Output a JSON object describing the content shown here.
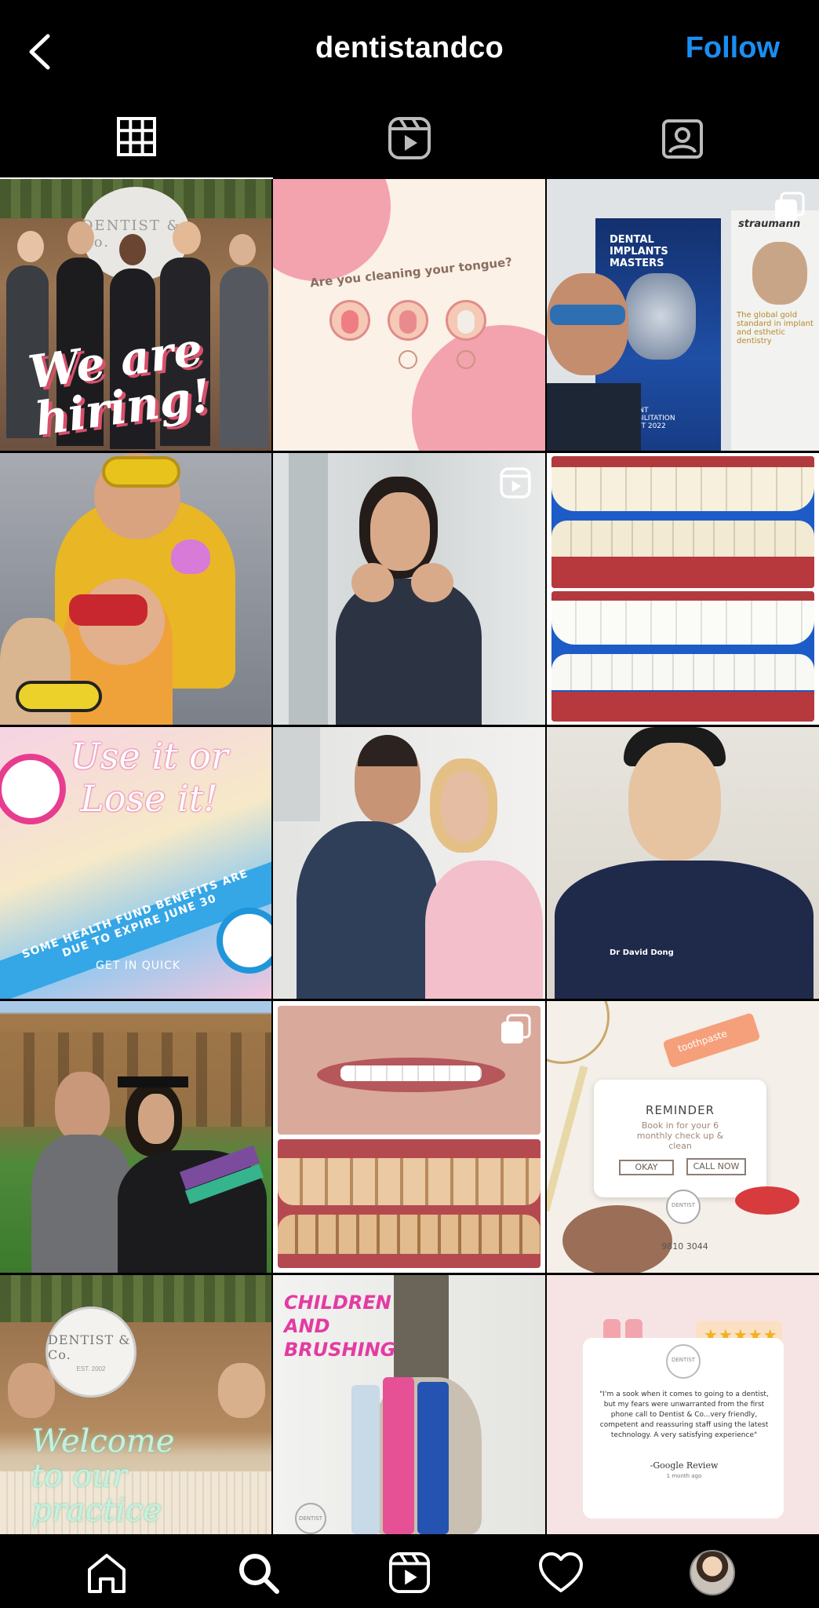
{
  "header": {
    "username": "dentistandco",
    "follow_label": "Follow"
  },
  "tabs": [
    {
      "icon": "grid-icon",
      "active": true
    },
    {
      "icon": "reels-icon",
      "active": false
    },
    {
      "icon": "tagged-icon",
      "active": false
    }
  ],
  "posts": [
    {
      "caption": "We are hiring!",
      "sign": "DENTIST & Co."
    },
    {
      "caption": "Are you cleaning your tongue?"
    },
    {
      "caption": "DENTAL IMPLANTS MASTERS",
      "sub": "IMPLANT REHABILITATION SUMMIT 2022",
      "side": "straumann",
      "side_text": "The global gold standard in implant and esthetic dentistry"
    },
    {
      "caption": ""
    },
    {
      "caption": ""
    },
    {
      "caption": ""
    },
    {
      "caption": "Use it or Lose it!",
      "sub": "SOME HEALTH FUND BENEFITS ARE DUE TO EXPIRE JUNE 30",
      "foot": "GET IN QUICK"
    },
    {
      "caption": ""
    },
    {
      "caption": "Dr David Dong"
    },
    {
      "caption": ""
    },
    {
      "caption": ""
    },
    {
      "caption": "REMINDER",
      "sub": "Book in for your 6 monthly check up & clean",
      "btn1": "OKAY",
      "btn2": "CALL NOW",
      "phone": "9810 3044",
      "tube": "toothpaste",
      "sign": "DENTIST"
    },
    {
      "caption": "Welcome to our practice",
      "sign": "DENTIST & Co.",
      "est": "EST. 2002"
    },
    {
      "caption": "CHILDREN AND BRUSHING",
      "sign": "DENTIST"
    },
    {
      "caption": "\"I'm a sook when it comes to going to a dentist, but my fears were unwarranted from the first phone call to Dentist & Co...very friendly, competent and reassuring staff using the latest technology. A very satisfying experience\"",
      "sub": "-Google Review",
      "foot": "1 month ago",
      "stars": "★★★★★",
      "sign": "DENTIST"
    }
  ],
  "colors": {
    "follow": "#1b8ef2",
    "background": "#000000"
  }
}
